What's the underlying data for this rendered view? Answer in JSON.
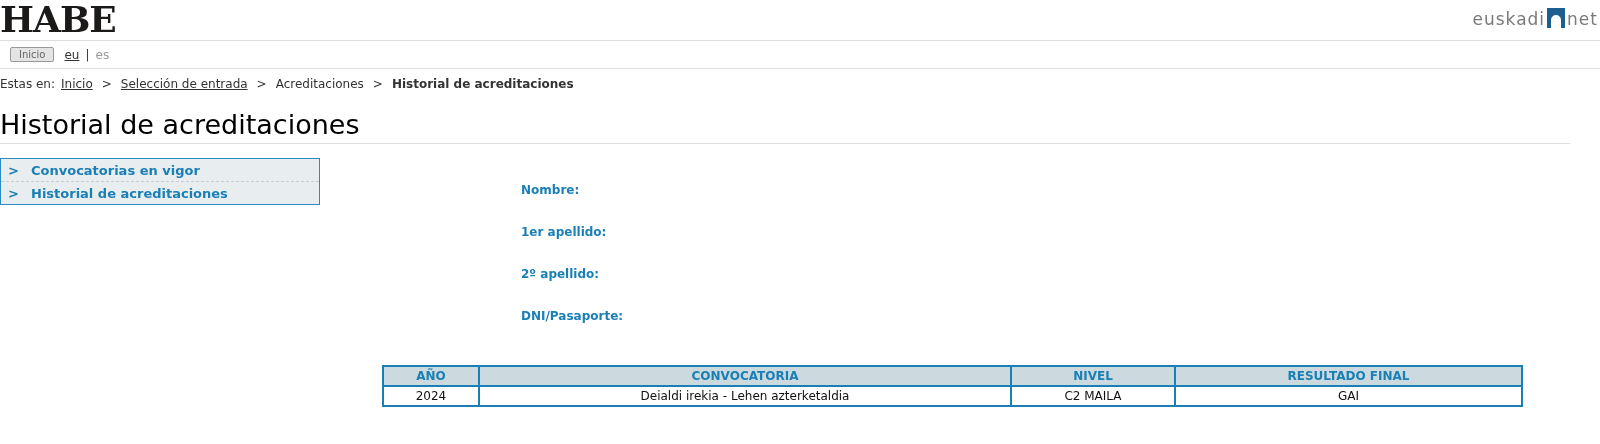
{
  "header": {
    "logo": "HABE",
    "partner_logo": {
      "left": "euskadi",
      "right": "net"
    }
  },
  "toolbar": {
    "home_button": {
      "label": "Inicio",
      "disabled": true
    },
    "languages": [
      {
        "label": "eu",
        "selected": false
      },
      {
        "label": "es",
        "selected": true
      }
    ],
    "separator": "|"
  },
  "breadcrumb": {
    "prefix": "Estas en:",
    "items": [
      {
        "label": "Inicio",
        "kind": "link"
      },
      {
        "label": "Selección de entrada",
        "kind": "link"
      },
      {
        "label": "Acreditaciones",
        "kind": "text"
      },
      {
        "label": "Historial de acreditaciones",
        "kind": "current"
      }
    ],
    "separator": ">"
  },
  "page_title": "Historial de acreditaciones",
  "sidebar": {
    "items": [
      {
        "marker": ">",
        "label": "Convocatorias en vigor"
      },
      {
        "marker": ">",
        "label": "Historial de acreditaciones"
      }
    ]
  },
  "form": {
    "fields": [
      {
        "label": "Nombre:"
      },
      {
        "label": "1er apellido:"
      },
      {
        "label": "2º apellido:"
      },
      {
        "label": "DNI/Pasaporte:"
      }
    ]
  },
  "table": {
    "columns": [
      "AÑO",
      "CONVOCATORIA",
      "NIVEL",
      "RESULTADO FINAL"
    ],
    "rows": [
      [
        "2024",
        "Deialdi irekia - Lehen azterketaldia",
        "C2 MAILA",
        "GAI"
      ]
    ]
  }
}
